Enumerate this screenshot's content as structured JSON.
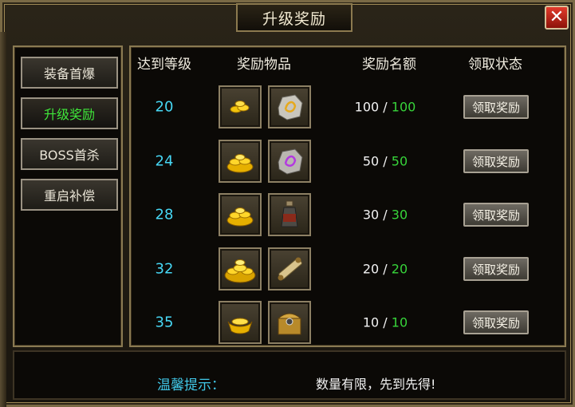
{
  "window": {
    "title": "升级奖励",
    "close_label": "✕"
  },
  "sidebar": {
    "tabs": [
      {
        "label": "装备首爆",
        "active": false
      },
      {
        "label": "升级奖励",
        "active": true
      },
      {
        "label": "BOSS首杀",
        "active": false
      },
      {
        "label": "重启补偿",
        "active": false
      }
    ]
  },
  "table": {
    "headers": {
      "level": "达到等级",
      "items": "奖励物品",
      "quota": "奖励名额",
      "status": "领取状态"
    },
    "rows": [
      {
        "level": "20",
        "items": [
          "gold-coins-small-icon",
          "silver-ore-rune-icon"
        ],
        "remaining": "100",
        "total": "100",
        "claim_label": "领取奖励"
      },
      {
        "level": "24",
        "items": [
          "gold-coins-pile-icon",
          "purple-ore-rune-icon"
        ],
        "remaining": "50",
        "total": "50",
        "claim_label": "领取奖励"
      },
      {
        "level": "28",
        "items": [
          "gold-coins-pile-icon",
          "potion-bottle-icon"
        ],
        "remaining": "30",
        "total": "30",
        "claim_label": "领取奖励"
      },
      {
        "level": "32",
        "items": [
          "gold-coins-heap-icon",
          "scroll-icon"
        ],
        "remaining": "20",
        "total": "20",
        "claim_label": "领取奖励"
      },
      {
        "level": "35",
        "items": [
          "gold-ingot-icon",
          "treasure-chest-icon"
        ],
        "remaining": "10",
        "total": "10",
        "claim_label": "领取奖励"
      }
    ]
  },
  "footer": {
    "tip_label": "温馨提示：",
    "tip_text": "数量有限，先到先得!"
  },
  "colors": {
    "level": "#47d8f5",
    "total": "#37d43a",
    "active_tab": "#3fe83a",
    "tip_label": "#41c8e8"
  }
}
